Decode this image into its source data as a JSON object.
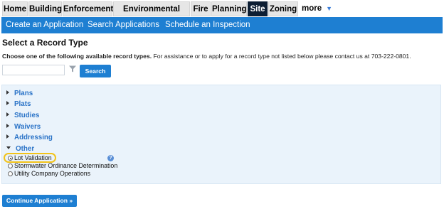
{
  "top_tabs": [
    {
      "label": "Home",
      "active": false
    },
    {
      "label": "Building",
      "active": false
    },
    {
      "label": "Enforcement",
      "active": false
    },
    {
      "label": "Environmental Health",
      "active": false
    },
    {
      "label": "Fire",
      "active": false
    },
    {
      "label": "Planning",
      "active": false
    },
    {
      "label": "Site",
      "active": true
    },
    {
      "label": "Zoning",
      "active": false
    }
  ],
  "more_label": "more",
  "subnav": {
    "links": [
      "Create an Application",
      "Search Applications",
      "Schedule an Inspection"
    ]
  },
  "page_title": "Select a Record Type",
  "instructions": {
    "bold": "Choose one of the following available record types.",
    "rest": " For assistance or to apply for a record type not listed below please contact us at 703-222-0801."
  },
  "search": {
    "value": "",
    "placeholder": "",
    "button_label": "Search"
  },
  "categories": [
    {
      "label": "Plans",
      "expanded": false
    },
    {
      "label": "Plats",
      "expanded": false
    },
    {
      "label": "Studies",
      "expanded": false
    },
    {
      "label": "Waivers",
      "expanded": false
    },
    {
      "label": "Addressing",
      "expanded": false
    },
    {
      "label": "Other",
      "expanded": true
    }
  ],
  "other_options": [
    {
      "label": "Lot Validation",
      "selected": true
    },
    {
      "label": "Stormwater Ordinance Determination",
      "selected": false
    },
    {
      "label": "Utility Company Operations",
      "selected": false
    }
  ],
  "continue_label": "Continue Application »",
  "colors": {
    "accent_blue": "#1e7fd2",
    "active_tab": "#0d1e33",
    "highlight": "#f2c319",
    "panel_bg": "#eaf3fb",
    "category_text": "#2a73c7"
  },
  "icons": {
    "filter": "filter-icon",
    "help": "help-icon",
    "more_caret": "caret-down-icon"
  }
}
